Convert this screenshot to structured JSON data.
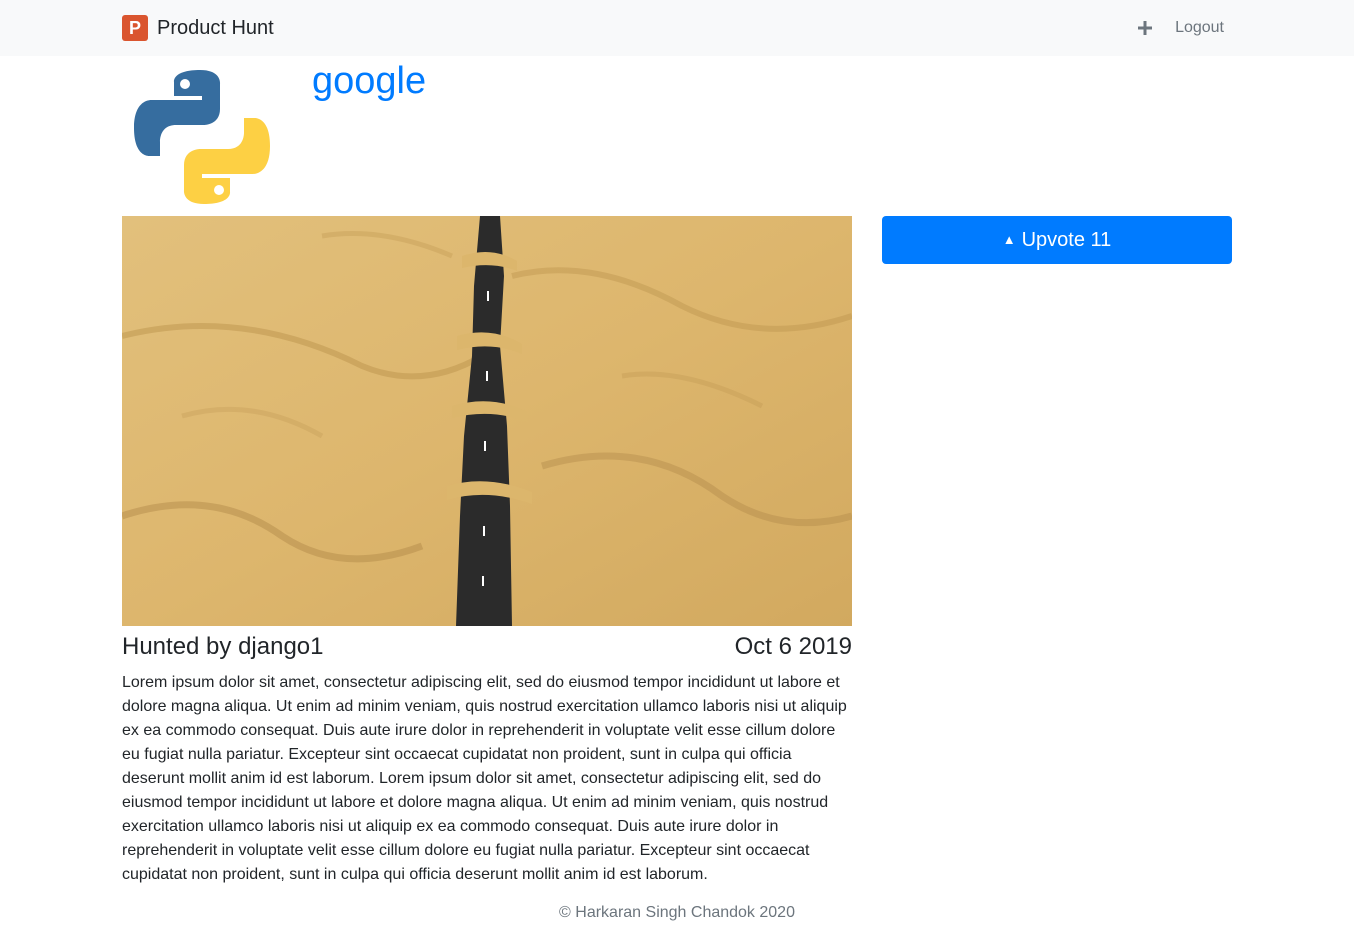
{
  "navbar": {
    "brand_letter": "P",
    "brand_name": "Product Hunt",
    "add_icon": "plus-icon",
    "logout_label": "Logout"
  },
  "product": {
    "title": "google",
    "icon": "python-logo",
    "hunted_by": "Hunted by django1",
    "date": "Oct 6 2019",
    "upvote_label": "Upvote 11",
    "body": "Lorem ipsum dolor sit amet, consectetur adipiscing elit, sed do eiusmod tempor incididunt ut labore et dolore magna aliqua. Ut enim ad minim veniam, quis nostrud exercitation ullamco laboris nisi ut aliquip ex ea commodo consequat. Duis aute irure dolor in reprehenderit in voluptate velit esse cillum dolore eu fugiat nulla pariatur. Excepteur sint occaecat cupidatat non proident, sunt in culpa qui officia deserunt mollit anim id est laborum. Lorem ipsum dolor sit amet, consectetur adipiscing elit, sed do eiusmod tempor incididunt ut labore et dolore magna aliqua. Ut enim ad minim veniam, quis nostrud exercitation ullamco laboris nisi ut aliquip ex ea commodo consequat. Duis aute irure dolor in reprehenderit in voluptate velit esse cillum dolore eu fugiat nulla pariatur. Excepteur sint occaecat cupidatat non proident, sunt in culpa qui officia deserunt mollit anim id est laborum."
  },
  "footer": {
    "copyright": "© Harkaran Singh Chandok 2020"
  },
  "colors": {
    "accent": "#007bff",
    "brand": "#da552f",
    "navbar_bg": "#f8f9fa"
  }
}
